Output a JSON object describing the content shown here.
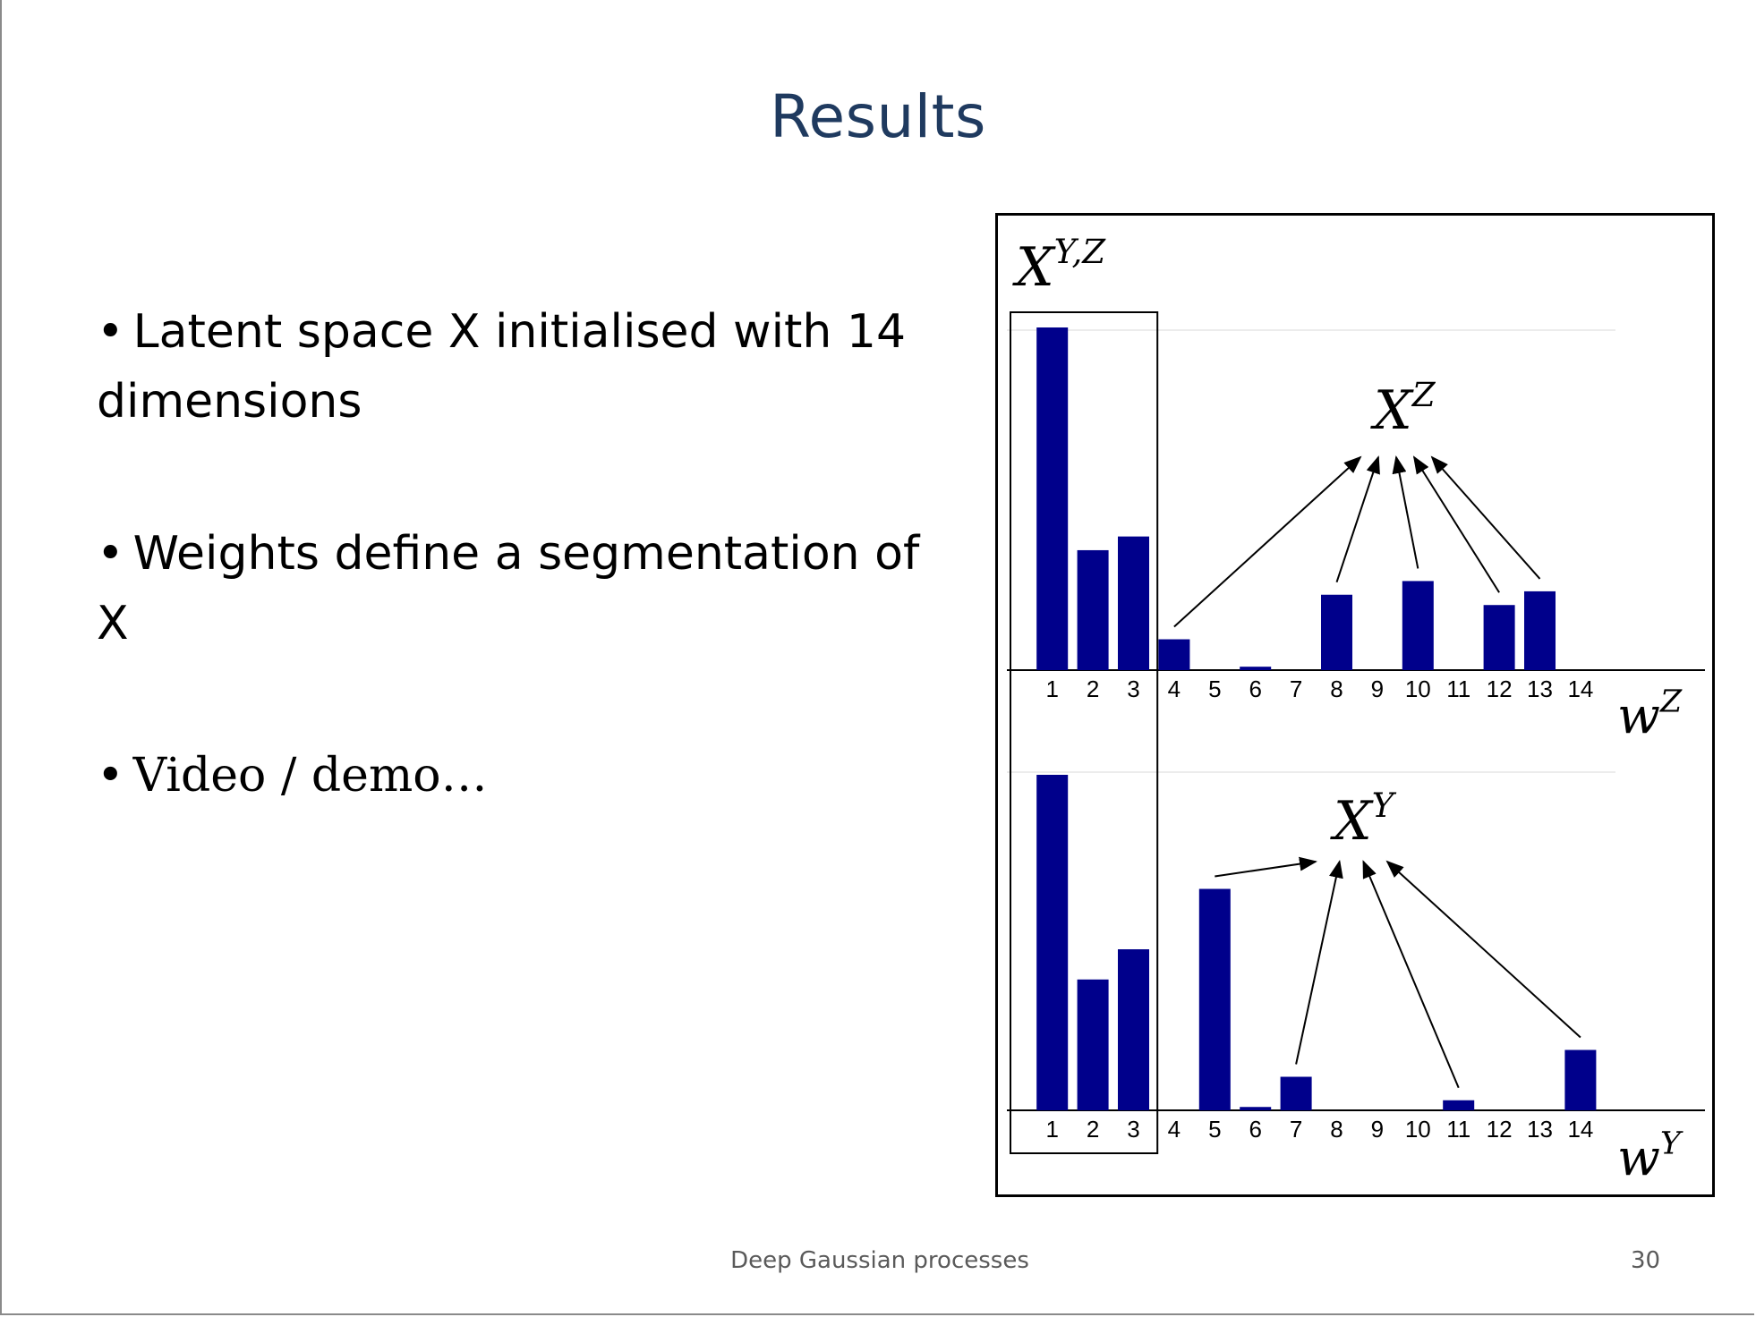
{
  "slide": {
    "title": "Results",
    "bullets": [
      {
        "bullet": "•",
        "text": "Latent space X initialised with 14 dimensions"
      },
      {
        "bullet": "•",
        "text": "Weights define a segmentation of X"
      },
      {
        "bullet": "•",
        "text": "Video / demo…"
      }
    ],
    "footer": "Deep Gaussian processes",
    "page_number": "30"
  },
  "colors": {
    "title": "#1f3a5f",
    "bar": "#00008b",
    "axis": "#000000",
    "footer": "#5a5a5a"
  },
  "chart_data": [
    {
      "type": "bar",
      "categories": [
        "1",
        "2",
        "3",
        "4",
        "5",
        "6",
        "7",
        "8",
        "9",
        "10",
        "11",
        "12",
        "13",
        "14"
      ],
      "values": [
        1.0,
        0.35,
        0.39,
        0.09,
        0.0,
        0.01,
        0.0,
        0.22,
        0.0,
        0.26,
        0.0,
        0.19,
        0.23,
        0.0
      ],
      "ylim": [
        0,
        1.0
      ],
      "xlabel": "w^Z",
      "ylabel": "",
      "title": "",
      "annotations": [
        {
          "text": "X^Z",
          "points_to": [
            "4",
            "8",
            "10",
            "12",
            "13"
          ]
        }
      ],
      "grid": false
    },
    {
      "type": "bar",
      "categories": [
        "1",
        "2",
        "3",
        "4",
        "5",
        "6",
        "7",
        "8",
        "9",
        "10",
        "11",
        "12",
        "13",
        "14"
      ],
      "values": [
        1.0,
        0.39,
        0.48,
        0.0,
        0.66,
        0.01,
        0.1,
        0.0,
        0.0,
        0.0,
        0.03,
        0.0,
        0.0,
        0.18
      ],
      "ylim": [
        0,
        1.0
      ],
      "xlabel": "w^Y",
      "ylabel": "",
      "title": "",
      "annotations": [
        {
          "text": "X^Y",
          "points_to": [
            "5",
            "7",
            "11",
            "14"
          ]
        }
      ],
      "grid": false
    }
  ],
  "figure": {
    "shared_label": "X^{Y,Z}",
    "shared_dims": [
      "1",
      "2",
      "3"
    ]
  }
}
